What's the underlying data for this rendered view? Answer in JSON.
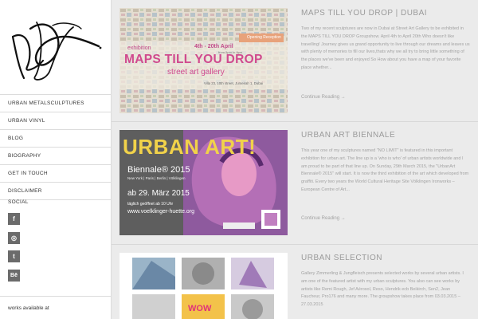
{
  "sidebar": {
    "logo_alt": "signature",
    "nav": [
      "URBAN METALSCULPTURES",
      "URBAN VINYL",
      "BLOG",
      "BIOGRAPHY",
      "GET IN TOUCH",
      "DISCLAIMER"
    ],
    "social_title": "SOCIAL",
    "social": [
      {
        "name": "facebook-icon",
        "glyph": "f"
      },
      {
        "name": "instagram-icon",
        "glyph": "◎"
      },
      {
        "name": "twitter-icon",
        "glyph": "t"
      },
      {
        "name": "behance-icon",
        "glyph": "Bē"
      }
    ],
    "works_text": "works available at"
  },
  "posts": [
    {
      "title": "MAPS TILL YOU DROP | DUBAI",
      "text": "Two of my recent sculptures are now in Dubai at Street Art Gallery to be exhibited in the MAPS TILL YOU DROP Groupshow. April 4th to April 20th Who doesn't like travelling! Journey gives us grand opportunity to live through our dreams and leaves us with plenty of memories to fill our lives,thats why we all try to bring little something of the places we've been and enjoyed So How about you have a map of your favorite place whether...",
      "continue": "Continue Reading →",
      "thumb": {
        "exhibition": "exhibition",
        "dates": "4th - 20th April",
        "time": "from 5pm to 9pm",
        "headline": "MAPS TILL YOU DROP",
        "gallery": "street art gallery",
        "address": "Villa 23, 10th street, Jumeirah 1, Dubai",
        "badge": "Opening Reception"
      }
    },
    {
      "title": "URBAN ART BIENNALE",
      "text": "This year one of my sculptures named \"NO LIMIT\" is featured in this important exhibition for urban art. The line up is a 'who is who' of urban artists worldwide and I am proud to be part of that line up. On Sunday, 29th March 2015, the \"UrbanArt Biennale® 2015\" will start. It is now the third exhibition of the art which developed from graffiti. Every two years the World Cultural Heritage Site Völklingen Ironworks – European Centre of Art...",
      "continue": "Continue Reading →",
      "thumb": {
        "headline": "URBAN ART!",
        "sub": "Biennale® 2015",
        "cities": "New York | Paris | Berlin | Völklingen",
        "date": "ab 29. März 2015",
        "daily": "täglich geöffnet ab 10 Uhr",
        "url": "www.voelklinger-huette.org"
      }
    },
    {
      "title": "URBAN SELECTION",
      "text": "Gallery Zimmerling & Jungfleisch presents selected works by several urban artists. I am one of the featured artist with my urban sculptures. You also can see works by artists like Remi Rough, Jef Aérosol, Reso, Hendrik ecb Beikirch, Sen2, Jean Faucheur, Pro176 and many more. The groupshow takes place from 03.03.2015 – 27.03.2015",
      "thumb": {
        "wow": "WOW"
      }
    }
  ],
  "colors": {
    "accent_magenta": "#e07ab0",
    "purple": "#7a3a9c",
    "muted_text": "#a3a3a3"
  }
}
